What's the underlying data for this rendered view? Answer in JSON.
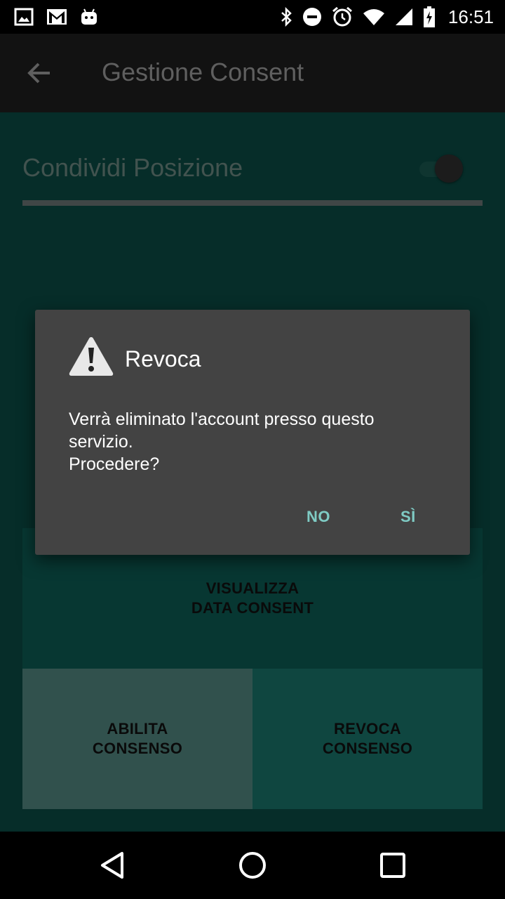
{
  "status_bar": {
    "time": "16:51",
    "left_icons": [
      "image-icon",
      "gmail-icon",
      "android-icon"
    ],
    "right_icons": [
      "bluetooth-icon",
      "do-not-disturb-icon",
      "alarm-icon",
      "wifi-icon",
      "signal-icon",
      "battery-charging-icon"
    ]
  },
  "app_bar": {
    "back_icon": "arrow-left-icon",
    "title": "Gestione Consent"
  },
  "settings": {
    "share_location_label": "Condividi Posizione",
    "share_location_enabled": false
  },
  "buttons": {
    "view_line1": "VISUALIZZA",
    "view_line2": "DATA CONSENT",
    "enable_line1": "ABILITA",
    "enable_line2": "CONSENSO",
    "revoke_line1": "REVOCA",
    "revoke_line2": "CONSENSO"
  },
  "dialog": {
    "icon": "warning-icon",
    "title": "Revoca",
    "message_line1": "Verrà eliminato l'account presso questo",
    "message_line2": "servizio.",
    "message_line3": "Procedere?",
    "negative": "NO",
    "positive": "SÌ"
  },
  "nav_bar": {
    "icons": [
      "back-triangle-icon",
      "home-circle-icon",
      "recents-square-icon"
    ]
  },
  "colors": {
    "content_bg": "#062d29",
    "app_bar_bg": "#121212",
    "dialog_bg": "#434343",
    "dialog_button": "#7fcbc4",
    "enable_button_bg": "#31514d",
    "revoke_button_bg": "#0f4640",
    "view_button_bg": "#073732"
  }
}
